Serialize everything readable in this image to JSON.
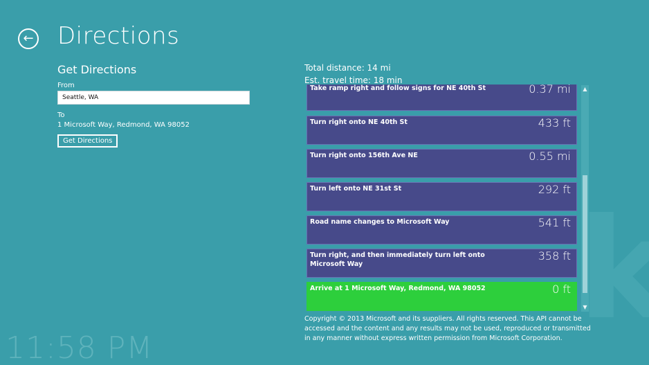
{
  "header": {
    "back_icon": "back-arrow-icon",
    "title": "Directions"
  },
  "form": {
    "section_title": "Get Directions",
    "from_label": "From",
    "from_value": "Seattle, WA",
    "to_label": "To",
    "to_value": "1 Microsoft Way, Redmond, WA 98052",
    "button_label": "Get Directions"
  },
  "summary": {
    "total_distance": "Total distance: 14 mi",
    "travel_time": "Est. travel time: 18 min"
  },
  "steps": [
    {
      "text": "Take ramp right and follow signs for NE 40th St",
      "distance": "0.37 mi"
    },
    {
      "text": "Turn right onto NE 40th St",
      "distance": "433 ft"
    },
    {
      "text": "Turn right onto 156th Ave NE",
      "distance": "0.55 mi"
    },
    {
      "text": "Turn left onto NE 31st St",
      "distance": "292 ft"
    },
    {
      "text": "Road name changes to Microsoft Way",
      "distance": "541 ft"
    },
    {
      "text": "Turn right, and then immediately turn left onto Microsoft Way",
      "distance": "358 ft"
    },
    {
      "text": "Arrive at 1 Microsoft Way, Redmond, WA 98052",
      "distance": "0 ft"
    }
  ],
  "scrollbar": {
    "up_icon": "chevron-up-icon",
    "down_icon": "chevron-down-icon"
  },
  "copyright": "Copyright © 2013 Microsoft and its suppliers. All rights reserved. This API cannot be accessed and the content and any results may not be used, reproduced or transmitted in any manner without express written permission from Microsoft Corporation.",
  "clock": "11:58 PM",
  "colors": {
    "background": "#3a9eaa",
    "step_background": "#474a8a",
    "arrive_background": "#2dcf3c"
  }
}
